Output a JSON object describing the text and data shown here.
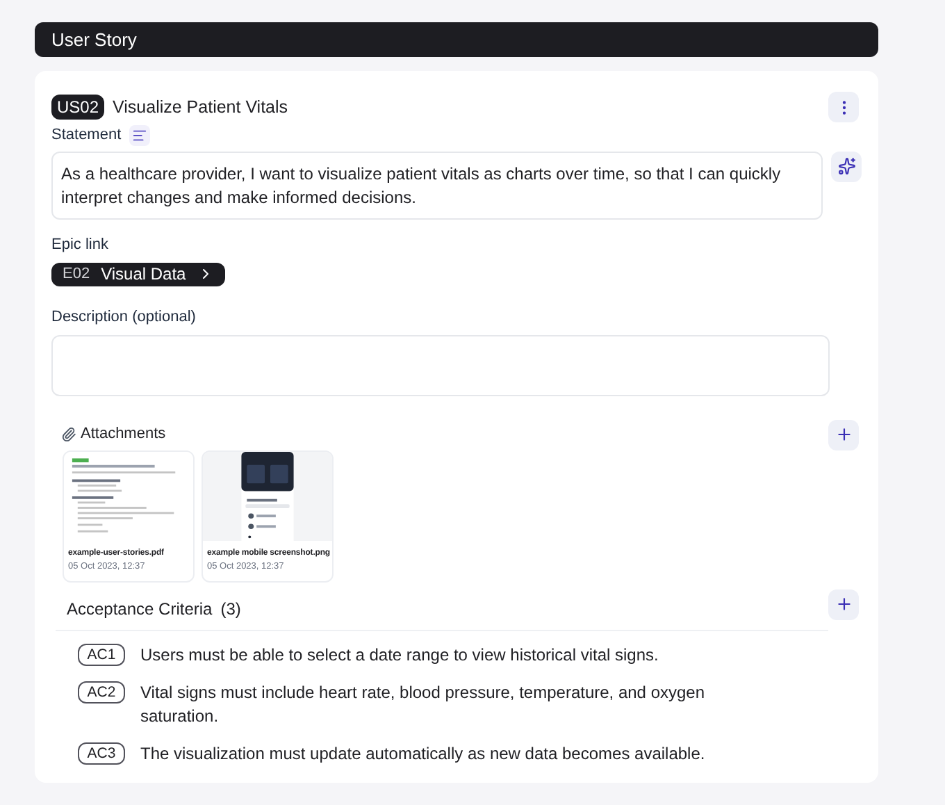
{
  "header": {
    "title": "User Story"
  },
  "story": {
    "id": "US02",
    "title": "Visualize Patient Vitals"
  },
  "statement": {
    "label": "Statement",
    "value": "As a healthcare provider, I want to visualize patient vitals as charts over time, so that I can quickly interpret changes and make informed decisions."
  },
  "epic_link": {
    "label": "Epic link",
    "id": "E02",
    "name": "Visual Data"
  },
  "description": {
    "label": "Description (optional)"
  },
  "attachments": {
    "label": "Attachments",
    "items": [
      {
        "kind": "document",
        "name": "example-user-stories.pdf",
        "date": "05 Oct 2023, 12:37"
      },
      {
        "kind": "phone",
        "name": "example mobile screenshot.png",
        "date": "05 Oct 2023, 12:37"
      }
    ]
  },
  "acceptance_criteria": {
    "label": "Acceptance Criteria",
    "count": "(3)",
    "items": [
      {
        "id": "AC1",
        "text": "Users must be able to select a date range to view historical vital signs."
      },
      {
        "id": "AC2",
        "text": "Vital signs must include heart rate, blood pressure, temperature, and oxygen saturation."
      },
      {
        "id": "AC3",
        "text": "The visualization must update automatically as new data becomes available."
      }
    ]
  }
}
